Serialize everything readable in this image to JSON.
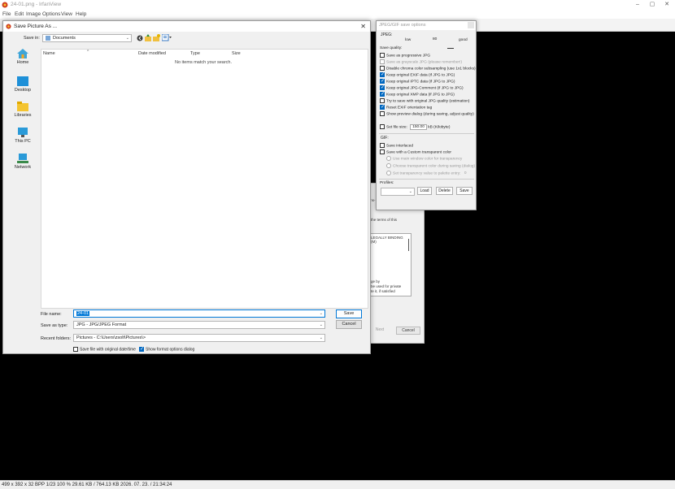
{
  "app": {
    "title": "24-01.png - IrfanView",
    "menu": [
      "File",
      "Edit",
      "Image",
      "Options",
      "View",
      "Help"
    ],
    "window_controls": [
      "–",
      "▢",
      "✕"
    ]
  },
  "statusbar": {
    "text": "499 x 392 x 32 BPP    1/23    100 %    29.61 KB / 764.13 KB    2026. 07. 23. / 21:34:24"
  },
  "bg_dialog": {
    "lines": [
      "Ins-",
      "the terms of this",
      "LEGALLY BINDING",
      "(M)",
      "ge by",
      "be used for private",
      "te it, if satisfied"
    ],
    "next_label": "Next",
    "cancel_label": "Cancel"
  },
  "save_dialog": {
    "title": "Save Picture As ...",
    "close_symbol": "✕",
    "save_in_label": "Save in:",
    "save_in_value": "Documents",
    "places": [
      "Home",
      "Desktop",
      "Libraries",
      "This PC",
      "Network"
    ],
    "columns": [
      "Name",
      "Date modified",
      "Type",
      "Size"
    ],
    "empty_message": "No items match your search.",
    "file_name_label": "File name:",
    "file_name_value": "24-01",
    "save_as_type_label": "Save as type:",
    "save_as_type_value": "JPG - JPG/JPEG Format",
    "recent_folders_label": "Recent folders:",
    "recent_folders_value": "Pictures  -  C:\\Users\\zsolt\\Pictures\\>",
    "save_button": "Save",
    "cancel_button": "Cancel",
    "checkboxes": [
      {
        "label": "Save file with original date/time",
        "checked": false
      },
      {
        "label": "Show format options dialog",
        "checked": true
      }
    ]
  },
  "options_panel": {
    "title": "JPEG/GIF save options",
    "jpeg_title": "JPEG:",
    "quality_low": "low",
    "quality_value": "80",
    "quality_good": "good",
    "save_quality_label": "Save quality:",
    "options": [
      {
        "label": "Save as progressive JPG",
        "checked": false,
        "disabled": false
      },
      {
        "label": "Save as grayscale JPG (please remember!)",
        "checked": false,
        "disabled": true
      },
      {
        "label": "Disable chroma color subsampling (use 1x1 blocks)",
        "checked": false,
        "disabled": false
      },
      {
        "label": "Keep original EXIF data (if JPG to JPG)",
        "checked": true,
        "disabled": false
      },
      {
        "label": "Keep original IPTC data (if JPG to JPG)",
        "checked": true,
        "disabled": false
      },
      {
        "label": "Keep original JPG-Comment (if JPG to JPG)",
        "checked": true,
        "disabled": false
      },
      {
        "label": "Keep original XMP data (if JPG to JPG)",
        "checked": true,
        "disabled": false
      },
      {
        "label": "Try to save with original JPG quality (estimation)",
        "checked": false,
        "disabled": false
      },
      {
        "label": "Reset EXIF orientation tag",
        "checked": true,
        "disabled": false
      },
      {
        "label": "Show preview dialog (during saving, adjust quality)",
        "checked": false,
        "disabled": false
      }
    ],
    "set_file_size_label": "Set file size:",
    "set_file_size_value": "150.00",
    "set_file_size_unit": "kB (Kilobyte)",
    "gif_title": "GIF:",
    "gif_interlaced": "Save interlaced",
    "gif_transparent": "Save with a Custom transparent color",
    "gif_radios": [
      "Use main window color for transparency",
      "Choose transparent color during saving (dialog)",
      "Set transparency value to palette entry:"
    ],
    "palette_value": "0",
    "profiles_label": "Profiles:",
    "load_button": "Load",
    "delete_button": "Delete",
    "save_button": "Save"
  }
}
